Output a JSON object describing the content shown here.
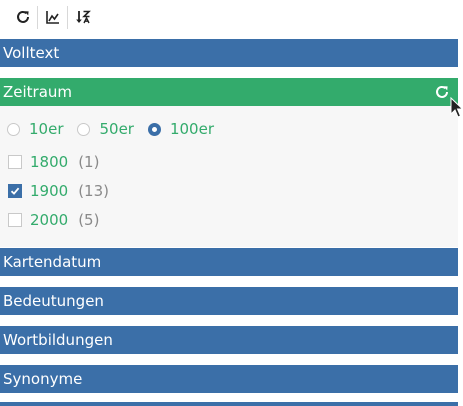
{
  "toolbar": {
    "buttons": [
      {
        "icon": "refresh-icon"
      },
      {
        "icon": "chart-icon"
      },
      {
        "icon": "sort-descending-icon"
      }
    ]
  },
  "sections": {
    "volltext": "Volltext",
    "zeitraum": "Zeitraum",
    "kartendatum": "Kartendatum",
    "bedeutungen": "Bedeutungen",
    "wortbildungen": "Wortbildungen",
    "synonyme": "Synonyme"
  },
  "zeitraum": {
    "granularity": [
      {
        "label": "10er",
        "checked": false
      },
      {
        "label": "50er",
        "checked": false
      },
      {
        "label": "100er",
        "checked": true
      }
    ],
    "items": [
      {
        "label": "1800",
        "count": "(1)",
        "checked": false
      },
      {
        "label": "1900",
        "count": "(13)",
        "checked": true
      },
      {
        "label": "2000",
        "count": "(5)",
        "checked": false
      }
    ]
  },
  "colors": {
    "header_blue": "#3b6fa8",
    "header_green": "#33ab6c",
    "label_green": "#33ab6c",
    "count_gray": "#8a8a8a"
  }
}
